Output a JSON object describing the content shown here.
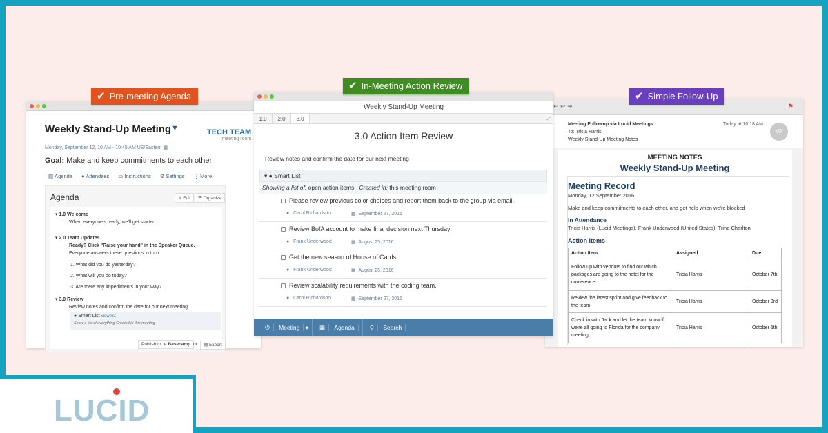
{
  "badges": {
    "premeeting": {
      "label": "Pre-meeting Agenda",
      "color": "#e0521e"
    },
    "inmeeting": {
      "label": "In-Meeting Action Review",
      "color": "#3f8c23"
    },
    "followup": {
      "label": "Simple Follow-Up",
      "color": "#6a3fbd"
    }
  },
  "agenda_window": {
    "title": "Weekly Stand-Up Meeting",
    "team_name": "TECH TEAM",
    "team_sub": "meeting room",
    "date": "Monday, September 12, 10 AM - 10:45 AM US/Eastern",
    "goal_label": "Goal:",
    "goal_text": " Make and keep commitments to each other",
    "tabs": [
      "Agenda",
      "Attendees",
      "Instructions",
      "Settings",
      "More"
    ],
    "heading": "Agenda",
    "edit_label": "Edit",
    "organize_label": "Organize",
    "items": {
      "i1_title": "1.0  Welcome",
      "i1_text": "When everyone's ready, we'll get started.",
      "i2_title": "2.0  Team Updates",
      "i2_bold": "Ready? Click \"Raise your hand\" in the Speaker Queue.",
      "i2_text": "Everyone answers these questions in turn:",
      "q1": "1. What did you do yesterday?",
      "q2": "2. What will you do today?",
      "q3": "3. Are there any impediments in your way?",
      "i3_title": "3.0  Review",
      "i3_text": "Review notes and confirm the date for our next meeting",
      "smart_label": "Smart List",
      "smart_link": "view list",
      "smart_sub": "Show a list of everything     Created in this meeting"
    },
    "publish_label": "Publish to",
    "basecamp_label": "Basecamp",
    "or_label": "or",
    "export_label": "Export"
  },
  "review_window": {
    "title": "Weekly Stand-Up Meeting",
    "tabs": [
      "1.0",
      "2.0",
      "3.0"
    ],
    "heading": "3.0 Action Item Review",
    "instruction": "Review notes and confirm the date for our next meeting",
    "smart_list": "Smart List",
    "showing_prefix": "Showing a list of:",
    "showing_value": " open action items",
    "created_prefix": "Created in:",
    "created_value": " this meeting room",
    "tasks": [
      {
        "text": "Please review previous color choices and report them back to the group via email.",
        "who": "Carol Richardson",
        "date": "September 27, 2016"
      },
      {
        "text": "Review BofA account to make final decision next Thursday",
        "who": "Frank Underwood",
        "date": "August 25, 2016"
      },
      {
        "text": "Get the new season of House of Cards.",
        "who": "Frank Underwood",
        "date": "August 25, 2016"
      },
      {
        "text": "Review scalability requirements with the coding team.",
        "who": "Carol Richardson",
        "date": "September 27, 2016"
      }
    ],
    "bar": {
      "meeting": "Meeting",
      "agenda": "Agenda",
      "search": "Search"
    }
  },
  "followup_window": {
    "subject": "Meeting Followup via Lucid Meetings",
    "to_label": "To:",
    "to_value": "Tricia Harris",
    "notes_line": "Weekly Stand-Up Meeting Notes",
    "received": "Today at 10:18 AM",
    "avatar": "MF",
    "meeting_notes": "MEETING NOTES",
    "meeting_title": "Weekly Stand-Up Meeting",
    "record_heading": "Meeting Record",
    "record_date": "Monday, 12 September 2016",
    "record_goal": "Make and keep commitments to each other, and get help when we're blocked",
    "attendance_heading": "In Attendance",
    "attendance": "Tricia Harris (Lucid Meetings), Frank Underwood (United States), Trina Charlton",
    "action_heading": "Action Items",
    "table_headers": [
      "Action Item",
      "Assigned",
      "Due"
    ],
    "rows": [
      {
        "item": "Follow up with vendors to find out which packages are going to the hotel for the conference.",
        "assigned": "Tricia Harris",
        "due": "October 7th"
      },
      {
        "item": "Review the latest sprint and give feedback to the team",
        "assigned": "Tricia Harris",
        "due": "October 3rd"
      },
      {
        "item": "Check in with Jack and let the team know if we're all going to Florida for the company meeting.",
        "assigned": "Tricia Harris",
        "due": "October 5th"
      }
    ]
  },
  "logo": {
    "text": "LUCID",
    "accent": "#e04040"
  }
}
